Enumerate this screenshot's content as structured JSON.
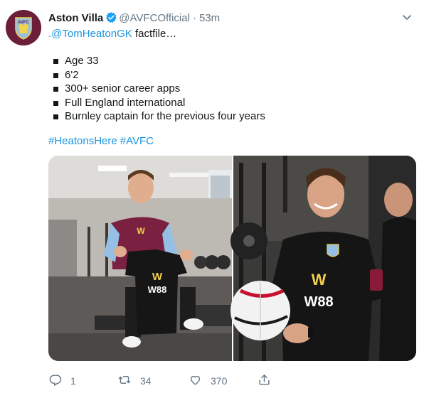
{
  "account": {
    "name": "Aston Villa",
    "handle": "@AVFCOfficial",
    "separator": "·",
    "time": "53m",
    "avatar_text": "AVFC"
  },
  "tweet": {
    "mention": ".@TomHeatonGK",
    "lead": " factfile…",
    "facts": [
      "Age 33",
      "6'2",
      "300+ senior career apps",
      "Full England international",
      "Burnley captain for the previous four years"
    ],
    "hashtags": [
      "#HeatonsHere",
      "#AVFC"
    ]
  },
  "media": {
    "shirt_sponsor": "W88",
    "shirt_sponsor_logo": "W"
  },
  "actions": {
    "replies": "1",
    "retweets": "34",
    "likes": "370"
  },
  "colors": {
    "link": "#1b95e0",
    "muted": "#657786",
    "claret": "#6b1f3b",
    "sky_blue": "#95bfe5",
    "verified": "#1da1f2"
  },
  "icons": [
    "verified-icon",
    "chevron-down-icon",
    "reply-icon",
    "retweet-icon",
    "like-icon",
    "share-icon"
  ]
}
